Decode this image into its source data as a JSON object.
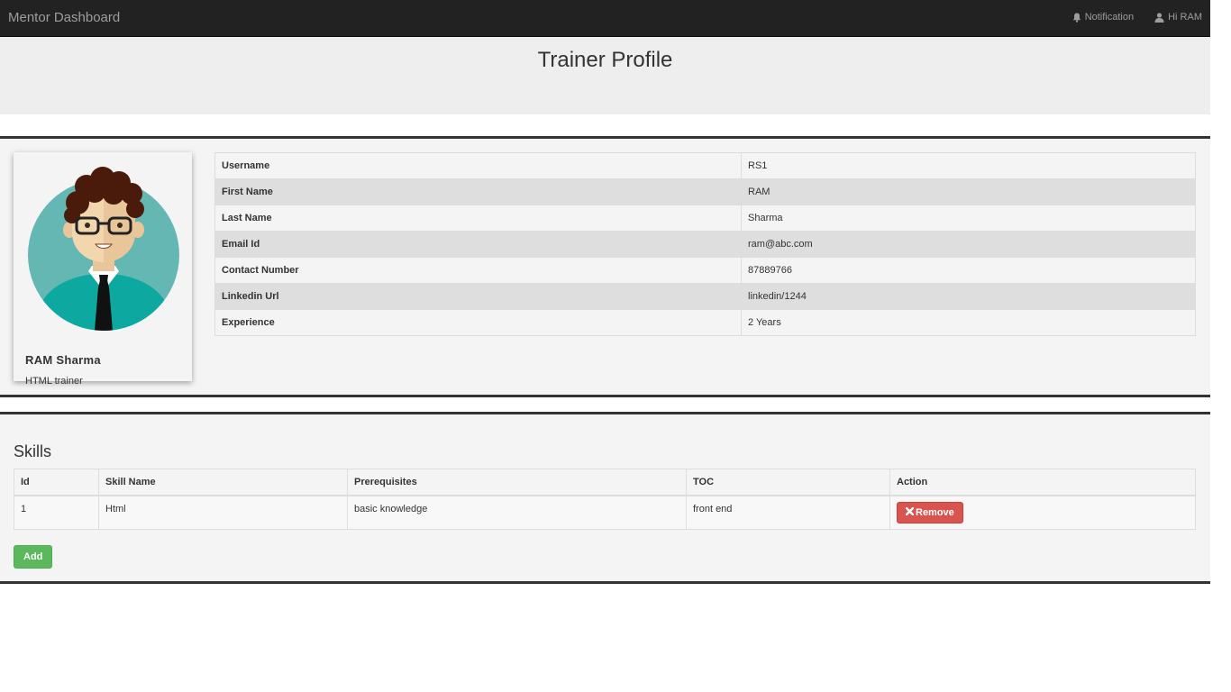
{
  "navbar": {
    "brand": "Mentor Dashboard",
    "notification_label": "Notification",
    "user_label": "Hi RAM",
    "notification_icon": "bell-icon",
    "user_icon": "user-icon"
  },
  "header": {
    "title": "Trainer Profile"
  },
  "profile": {
    "name": "RAM Sharma",
    "role": "HTML trainer",
    "avatar_icon": "trainer-avatar",
    "details": [
      {
        "key": "Username",
        "value": "RS1"
      },
      {
        "key": "First Name",
        "value": "RAM"
      },
      {
        "key": "Last Name",
        "value": "Sharma"
      },
      {
        "key": "Email Id",
        "value": "ram@abc.com"
      },
      {
        "key": "Contact Number",
        "value": "87889766"
      },
      {
        "key": "Linkedin Url",
        "value": "linkedin/1244"
      },
      {
        "key": "Experience",
        "value": "2 Years"
      }
    ]
  },
  "skills": {
    "title": "Skills",
    "columns": [
      "Id",
      "Skill Name",
      "Prerequisites",
      "TOC",
      "Action"
    ],
    "rows": [
      {
        "id": "1",
        "skill_name": "Html",
        "prerequisites": "basic knowledge",
        "toc": "front end",
        "action_label": "Remove"
      }
    ],
    "add_label": "Add"
  },
  "colors": {
    "navbar": "#222222",
    "remove_button": "#d9534f",
    "add_button": "#5cb85c",
    "avatar_circle": "#64b7b3"
  }
}
